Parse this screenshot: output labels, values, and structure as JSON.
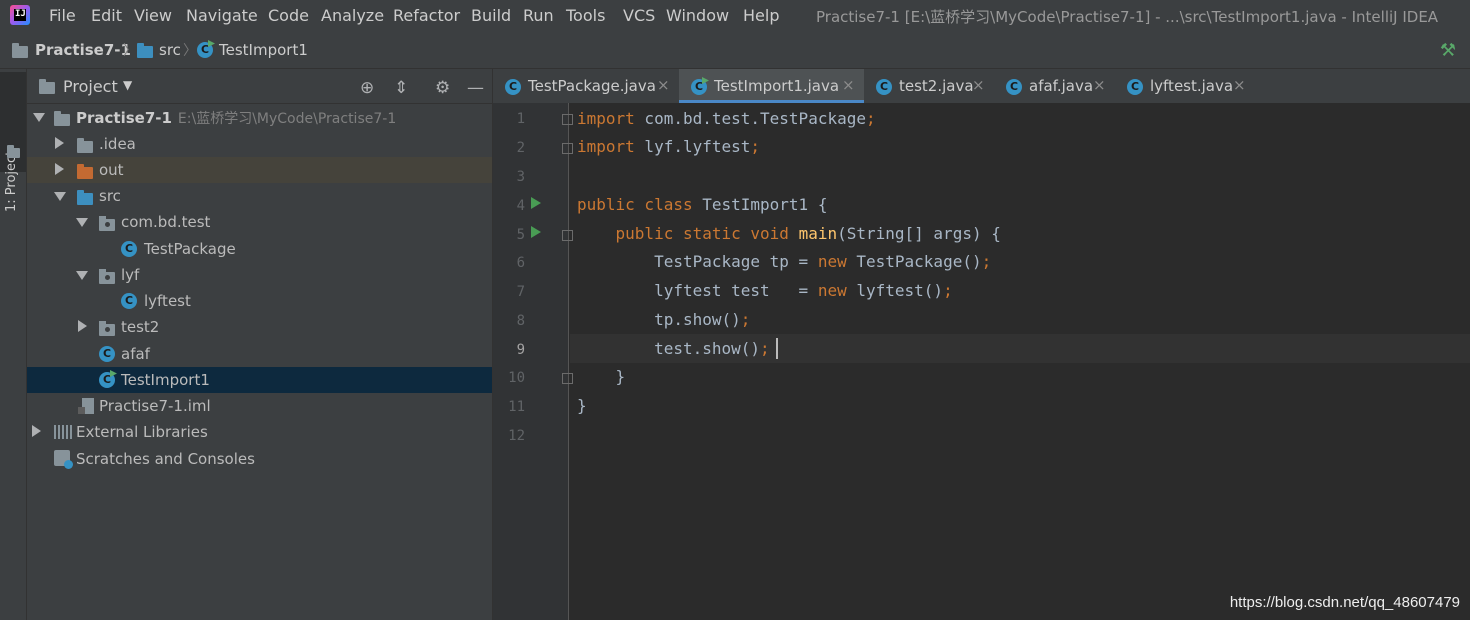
{
  "menubar": {
    "logo_letters": "IJ",
    "items": [
      "File",
      "Edit",
      "View",
      "Navigate",
      "Code",
      "Analyze",
      "Refactor",
      "Build",
      "Run",
      "Tools",
      "VCS",
      "Window",
      "Help"
    ],
    "window_title": "Practise7-1 [E:\\蓝桥学习\\MyCode\\Practise7-1] - ...\\src\\TestImport1.java - IntelliJ IDEA"
  },
  "breadcrumb": {
    "project": "Practise7-1",
    "folder": "src",
    "file": "TestImport1"
  },
  "left_strip": {
    "label": "1: Project"
  },
  "project_panel": {
    "title": "Project",
    "tree": {
      "root": "Practise7-1",
      "root_path": "E:\\蓝桥学习\\MyCode\\Practise7-1",
      "idea": ".idea",
      "out": "out",
      "src": "src",
      "pkg_com": "com.bd.test",
      "testpackage": "TestPackage",
      "pkg_lyf": "lyf",
      "lyftest": "lyftest",
      "pkg_test2": "test2",
      "afaf": "afaf",
      "testimport1": "TestImport1",
      "iml": "Practise7-1.iml",
      "external_libraries": "External Libraries",
      "scratches": "Scratches and Consoles"
    }
  },
  "editor_tabs": [
    "TestPackage.java",
    "TestImport1.java",
    "test2.java",
    "afaf.java",
    "lyftest.java"
  ],
  "active_tab": "TestImport1.java",
  "editor": {
    "line_numbers": [
      "1",
      "2",
      "3",
      "4",
      "5",
      "6",
      "7",
      "8",
      "9",
      "10",
      "11",
      "12"
    ],
    "code": {
      "l1_kw": "import",
      "l1_rest": " com.bd.test.TestPackage",
      "l2_kw": "import",
      "l2_rest": " lyf.lyftest",
      "l4_kw": "public class",
      "l4_rest": " TestImport1 {",
      "l5_indent": "    ",
      "l5_kw": "public static void",
      "l5_fn": "main",
      "l5_rest": "(String[] args) {",
      "l6_a": "        TestPackage tp = ",
      "l6_kw": "new",
      "l6_b": " TestPackage()",
      "l7_a": "        lyftest test   = ",
      "l7_kw": "new",
      "l7_b": " lyftest()",
      "l8_a": "        tp.show()",
      "l9_a": "        test.show()",
      "l10": "    }",
      "l11": "}",
      "semi": ";"
    }
  },
  "watermark": "https://blog.csdn.net/qq_48607479",
  "colors": {
    "keyword": "#cc7832",
    "method": "#ffc66d",
    "text": "#a9b7c6",
    "accent": "#4a88c7",
    "run": "#499c54"
  },
  "icons": {
    "locate": "crosshair-icon",
    "collapse": "collapse-all-icon",
    "settings": "gear-icon",
    "hide": "minimize-icon",
    "build": "hammer-icon"
  }
}
